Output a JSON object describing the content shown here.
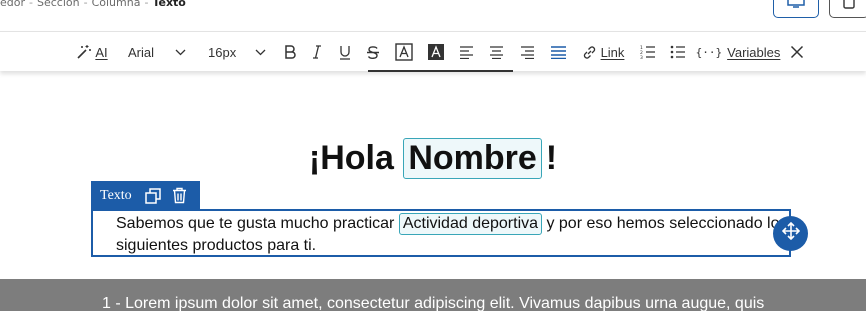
{
  "breadcrumb": {
    "items": [
      "edor",
      "Sección",
      "Columna"
    ],
    "current": "Texto"
  },
  "devices": {
    "desktop_icon": "desktop-icon",
    "mobile_icon": "mobile-icon"
  },
  "toolbar": {
    "ai_label": "AI",
    "font_family": "Arial",
    "font_size": "16px",
    "link_label": "Link",
    "variables_label": "Variables",
    "variables_prefix": "{··}"
  },
  "content": {
    "heading_prefix": "¡Hola",
    "heading_tag": "Nombre",
    "heading_suffix": "!",
    "block_label": "Texto",
    "paragraph_before": "Sabemos que te gusta mucho practicar",
    "paragraph_tag": "Actividad deportiva",
    "paragraph_after": " y por eso hemos seleccionado los siguientes productos para ti.",
    "footer_text": "1 - Lorem ipsum dolor sit amet, consectetur adipiscing elit. Vivamus dapibus urna augue, quis"
  },
  "colors": {
    "accent": "#1c5ca8",
    "tag_border": "#39a6b8",
    "grey_section": "#7d7d7d"
  }
}
